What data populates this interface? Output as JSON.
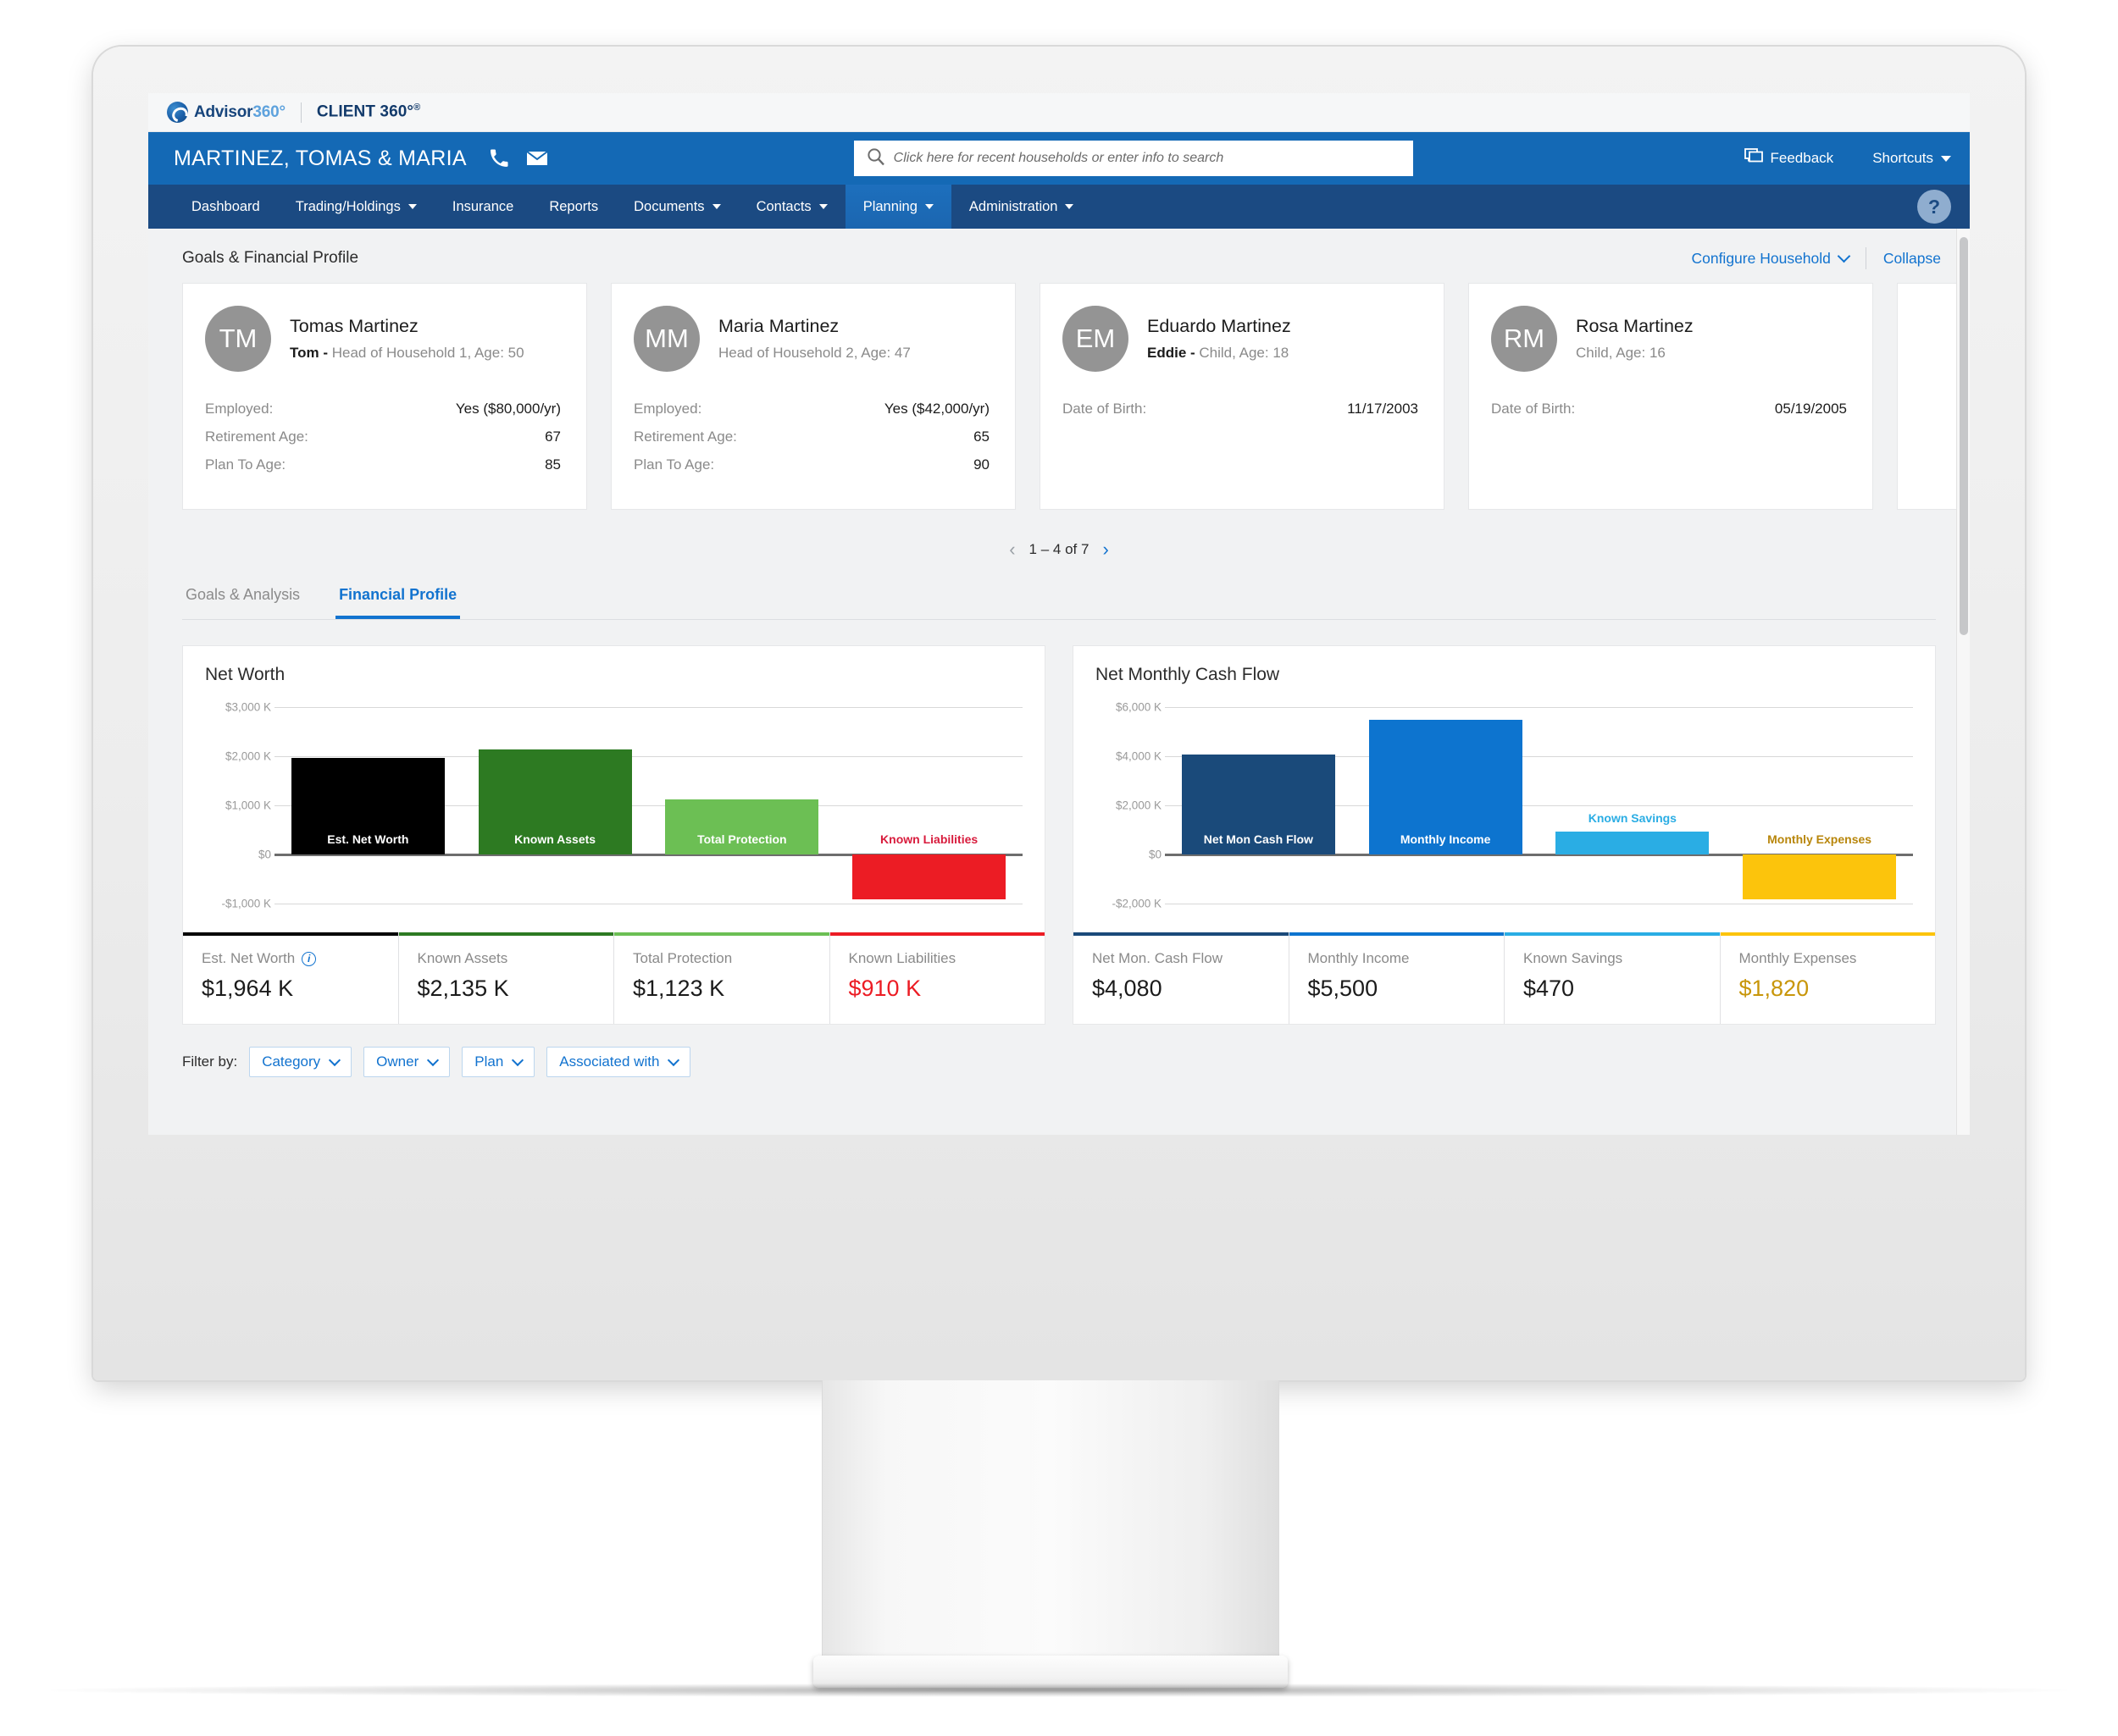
{
  "brand": {
    "logo_text": "Advisor",
    "logo_text_light": "360°",
    "product": "CLIENT 360°",
    "product_reg": "®"
  },
  "topbar": {
    "household": "MARTINEZ, TOMAS & MARIA",
    "phone_icon": "phone-icon",
    "email_icon": "envelope-icon",
    "feedback_label": "Feedback",
    "shortcuts_label": "Shortcuts",
    "help_label": "?"
  },
  "search": {
    "value": "",
    "placeholder": "Click here for recent households or enter info to search",
    "icon": "search-icon"
  },
  "nav": {
    "items": [
      {
        "label": "Dashboard",
        "has_caret": false,
        "active": false
      },
      {
        "label": "Trading/Holdings",
        "has_caret": true,
        "active": false
      },
      {
        "label": "Insurance",
        "has_caret": false,
        "active": false
      },
      {
        "label": "Reports",
        "has_caret": false,
        "active": false
      },
      {
        "label": "Documents",
        "has_caret": true,
        "active": false
      },
      {
        "label": "Contacts",
        "has_caret": true,
        "active": false
      },
      {
        "label": "Planning",
        "has_caret": true,
        "active": true
      },
      {
        "label": "Administration",
        "has_caret": true,
        "active": false
      }
    ]
  },
  "page": {
    "title": "Goals & Financial Profile",
    "configure_label": "Configure Household",
    "collapse_label": "Collapse"
  },
  "people": [
    {
      "initials": "TM",
      "name": "Tomas Martinez",
      "nickname": "Tom -",
      "relation": " Head of Household 1, Age: 50",
      "rows": [
        {
          "label": "Employed:",
          "value": "Yes ($80,000/yr)"
        },
        {
          "label": "Retirement Age:",
          "value": "67"
        },
        {
          "label": "Plan To Age:",
          "value": "85"
        }
      ]
    },
    {
      "initials": "MM",
      "name": "Maria Martinez",
      "nickname": "",
      "relation": "Head of Household 2, Age: 47",
      "rows": [
        {
          "label": "Employed:",
          "value": "Yes ($42,000/yr)"
        },
        {
          "label": "Retirement Age:",
          "value": "65"
        },
        {
          "label": "Plan To Age:",
          "value": "90"
        }
      ]
    },
    {
      "initials": "EM",
      "name": "Eduardo Martinez",
      "nickname": "Eddie -",
      "relation": " Child, Age: 18",
      "rows": [
        {
          "label": "Date of Birth:",
          "value": "11/17/2003"
        }
      ]
    },
    {
      "initials": "RM",
      "name": "Rosa Martinez",
      "nickname": "",
      "relation": "Child, Age: 16",
      "rows": [
        {
          "label": "Date of Birth:",
          "value": "05/19/2005"
        }
      ]
    }
  ],
  "pager": {
    "prev": "‹",
    "text": "1 – 4 of 7",
    "next": "›"
  },
  "tabs": [
    {
      "label": "Goals & Analysis",
      "active": false
    },
    {
      "label": "Financial Profile",
      "active": true
    }
  ],
  "chart_data": [
    {
      "type": "bar",
      "title": "Net Worth",
      "categories": [
        "Est. Net Worth",
        "Known Assets",
        "Total Protection",
        "Known Liabilities"
      ],
      "values": [
        1964,
        2135,
        1123,
        -910
      ],
      "colors": [
        "#000000",
        "#2d7a22",
        "#6cbf54",
        "#ec1c24"
      ],
      "label_colors": [
        "#ffffff",
        "#ffffff",
        "#ffffff",
        "#d81b3c"
      ],
      "ylabel": "",
      "xlabel": "",
      "ylim": [
        -1000,
        3000
      ],
      "yticks": [
        3000,
        2000,
        1000,
        0,
        -1000
      ],
      "ytick_labels": [
        "$3,000 K",
        "$2,000 K",
        "$1,000 K",
        "$0",
        "-$1,000 K"
      ],
      "grid": true,
      "legend": "none"
    },
    {
      "type": "bar",
      "title": "Net Monthly Cash Flow",
      "categories": [
        "Net Mon Cash Flow",
        "Monthly Income",
        "Known Savings",
        "Monthly Expenses"
      ],
      "values": [
        4080,
        5500,
        940,
        -1820
      ],
      "colors": [
        "#1a4a7a",
        "#0d74cf",
        "#2aade4",
        "#fcc40c"
      ],
      "label_colors": [
        "#ffffff",
        "#ffffff",
        "#2aade4",
        "#b8860b"
      ],
      "ylabel": "",
      "xlabel": "",
      "ylim": [
        -2000,
        6000
      ],
      "yticks": [
        6000,
        4000,
        2000,
        0,
        -2000
      ],
      "ytick_labels": [
        "$6,000 K",
        "$4,000 K",
        "$2,000 K",
        "$0",
        "-$2,000 K"
      ],
      "grid": true,
      "legend": "none"
    }
  ],
  "kpis_net_worth": [
    {
      "label": "Est. Net Worth",
      "value": "$1,964 K",
      "accent": "#000000",
      "value_color": "#1b1b1b",
      "info": true
    },
    {
      "label": "Known Assets",
      "value": "$2,135 K",
      "accent": "#2d7a22",
      "value_color": "#1b1b1b",
      "info": false
    },
    {
      "label": "Total Protection",
      "value": "$1,123 K",
      "accent": "#6cbf54",
      "value_color": "#1b1b1b",
      "info": false
    },
    {
      "label": "Known Liabilities",
      "value": "$910 K",
      "accent": "#ec1c24",
      "value_color": "#ec1c24",
      "info": false
    }
  ],
  "kpis_cash_flow": [
    {
      "label": "Net Mon. Cash Flow",
      "value": "$4,080",
      "accent": "#1a4a7a",
      "value_color": "#1b1b1b",
      "info": false
    },
    {
      "label": "Monthly Income",
      "value": "$5,500",
      "accent": "#0d74cf",
      "value_color": "#1b1b1b",
      "info": false
    },
    {
      "label": "Known Savings",
      "value": "$470",
      "accent": "#2aade4",
      "value_color": "#1b1b1b",
      "info": false
    },
    {
      "label": "Monthly Expenses",
      "value": "$1,820",
      "accent": "#fcc40c",
      "value_color": "#c8960a",
      "info": false
    }
  ],
  "filters": {
    "label": "Filter by:",
    "chips": [
      "Category",
      "Owner",
      "Plan",
      "Associated with"
    ]
  }
}
